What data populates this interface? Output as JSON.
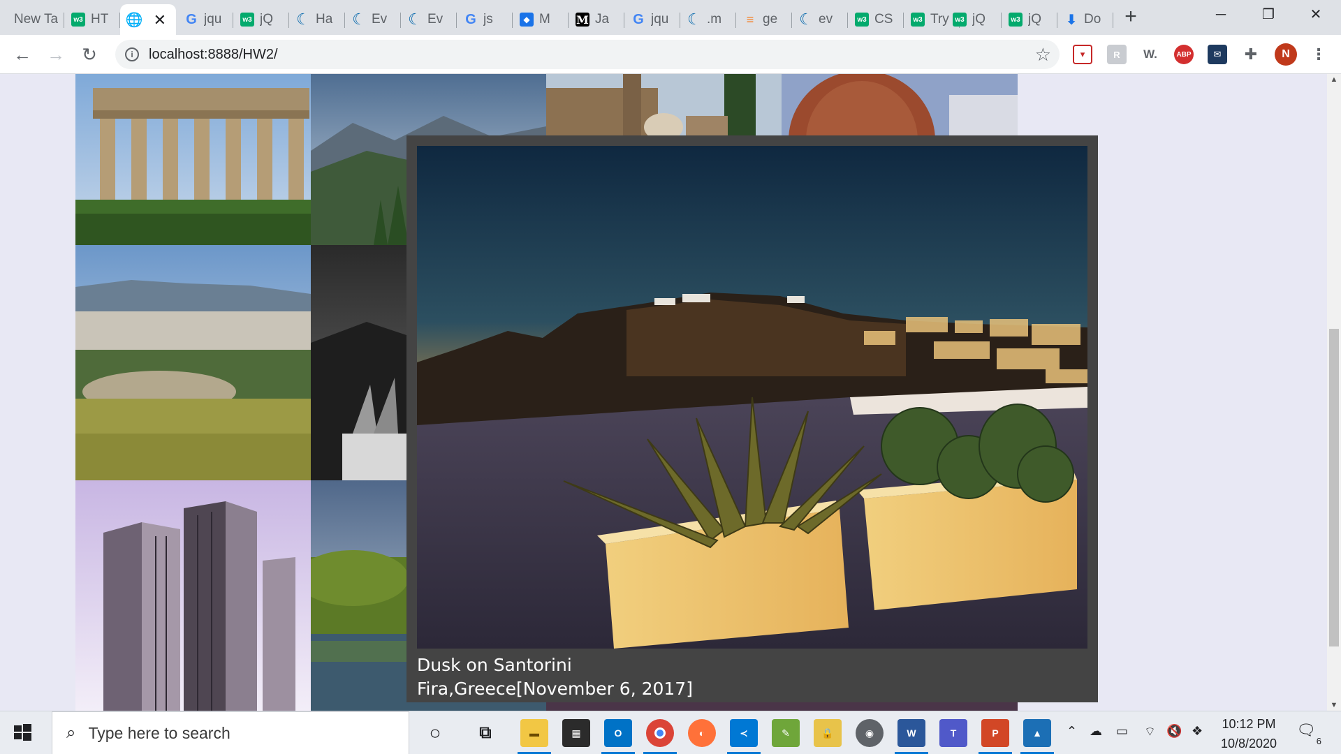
{
  "browser": {
    "tabs": [
      {
        "title": "New Ta",
        "icon": "none"
      },
      {
        "title": "HT",
        "icon": "w3schools-icon"
      },
      {
        "title": "",
        "icon": "globe-icon",
        "active": true
      },
      {
        "title": "jqu",
        "icon": "google-icon"
      },
      {
        "title": "jQ",
        "icon": "w3schools-icon"
      },
      {
        "title": "Ha",
        "icon": "jquery-icon"
      },
      {
        "title": "Ev",
        "icon": "jquery-icon"
      },
      {
        "title": "Ev",
        "icon": "jquery-icon"
      },
      {
        "title": "js",
        "icon": "google-icon"
      },
      {
        "title": "M",
        "icon": "mdn-icon"
      },
      {
        "title": "Ja",
        "icon": "medium-icon"
      },
      {
        "title": "jqu",
        "icon": "google-icon"
      },
      {
        "title": ".m",
        "icon": "jquery-icon"
      },
      {
        "title": "ge",
        "icon": "stackoverflow-icon"
      },
      {
        "title": "ev",
        "icon": "jquery-icon"
      },
      {
        "title": "CS",
        "icon": "w3schools-icon"
      },
      {
        "title": "Try",
        "icon": "w3schools-icon"
      },
      {
        "title": "jQ",
        "icon": "w3schools-icon"
      },
      {
        "title": "jQ",
        "icon": "w3schools-icon"
      },
      {
        "title": "Do",
        "icon": "download-icon"
      }
    ],
    "new_tab": "+",
    "window_controls": {
      "minimize": "─",
      "restore": "❐",
      "close": "✕"
    },
    "address": "localhost:8888/HW2/",
    "profile_initial": "N",
    "extensions": {
      "abp": "ABP",
      "w": "W."
    }
  },
  "lightbox": {
    "title": "Dusk on Santorini",
    "subtitle": "Fira,Greece[November 6, 2017]"
  },
  "taskbar": {
    "search_placeholder": "Type here to search",
    "time": "10:12 PM",
    "date": "10/8/2020",
    "notification_count": "6",
    "apps": [
      "cortana",
      "task-view",
      "file-explorer",
      "store",
      "outlook",
      "chrome",
      "firefox",
      "vscode",
      "paint",
      "security",
      "github",
      "word",
      "teams",
      "powerpoint",
      "photos"
    ]
  },
  "colors": {
    "accent": "#0078d4",
    "lightbox_bg": "#444444",
    "page_bg": "#e8e8f4",
    "w3schools": "#04aa6d"
  }
}
